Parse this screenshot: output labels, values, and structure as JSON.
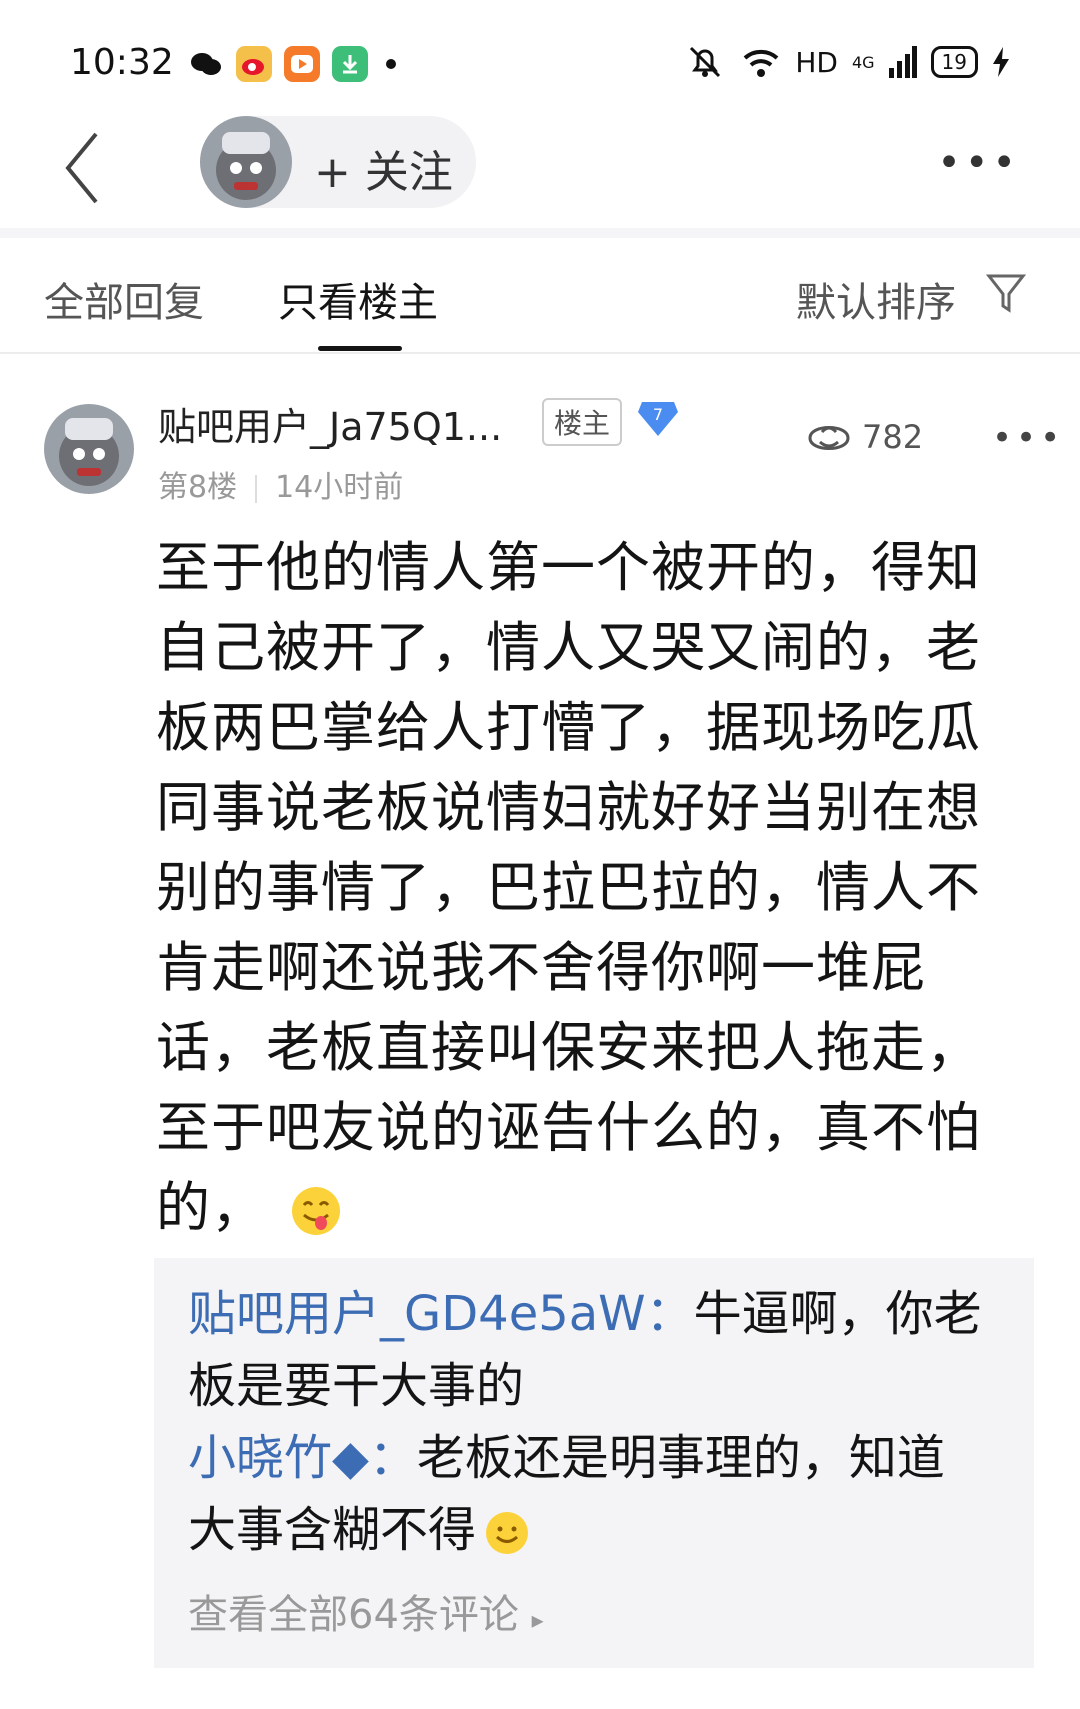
{
  "status_bar": {
    "time": "10:32",
    "app_icons": [
      "wechat-icon",
      "weibo-icon",
      "video-app-icon",
      "download-icon"
    ],
    "network": "HD",
    "signal": "4G",
    "battery": "19"
  },
  "header": {
    "follow_label": "+ 关注",
    "more_label": "•••"
  },
  "tabs": {
    "all_replies": "全部回复",
    "only_op": "只看楼主",
    "active": "只看楼主",
    "sort_label": "默认排序"
  },
  "post": {
    "username": "贴吧用户_Ja75Q1...",
    "op_badge": "楼主",
    "level": "7",
    "floor": "第8楼",
    "time": "14小时前",
    "likes": "782",
    "more_label": "•••",
    "content": "至于他的情人第一个被开的，得知自己被开了，情人又哭又闹的，老板两巴掌给人打懵了，据现场吃瓜同事说老板说情妇就好好当别在想别的事情了，巴拉巴拉的，情人不肯走啊还说我不舍得你啊一堆屁话，老板直接叫保安来把人拖走，至于吧友说的诬告什么的，真不怕的，",
    "content_emoji": "tongue-emoji"
  },
  "replies": {
    "items": [
      {
        "name": "贴吧用户_GD4e5aW：",
        "text": "牛逼啊，你老板是要干大事的"
      },
      {
        "name": "小晓竹◆：",
        "text": "老板还是明事理的，知道大事含糊不得",
        "emoji": "smile-emoji"
      }
    ],
    "view_all": "查看全部64条评论"
  },
  "colors": {
    "reply_name": "#3c6cb4",
    "level_badge": "#4a8cf0",
    "reply_bg": "#f4f4f6"
  }
}
